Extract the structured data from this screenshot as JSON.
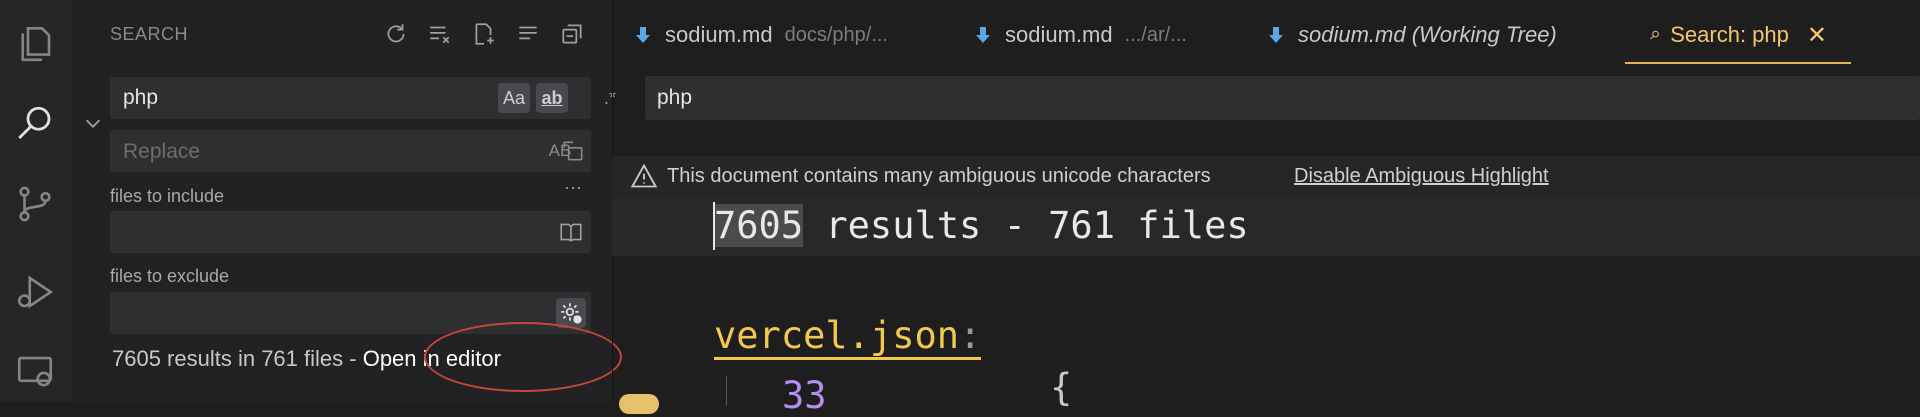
{
  "activity_bar": {
    "items": [
      "explorer-icon",
      "search-icon",
      "source-control-icon",
      "run-debug-icon",
      "remote-explorer-icon"
    ]
  },
  "sidebar": {
    "title": "SEARCH",
    "search": {
      "value": "php",
      "options": [
        "Aa",
        "ab"
      ],
      "regex_label": ".*"
    },
    "replace": {
      "placeholder": "Replace",
      "preserve_case": "AB"
    },
    "more": "···",
    "include": {
      "label": "files to include",
      "value": ""
    },
    "exclude": {
      "label": "files to exclude",
      "value": ""
    },
    "summary": {
      "text": "7605 results in 761 files - ",
      "link": "Open in editor"
    }
  },
  "tabs": [
    {
      "name": "sodium.md",
      "desc": "docs/php/...",
      "italic": false,
      "active": false
    },
    {
      "name": "sodium.md",
      "desc": ".../ar/...",
      "italic": false,
      "active": false
    },
    {
      "name": "sodium.md (Working Tree)",
      "desc": "",
      "italic": true,
      "active": false
    },
    {
      "name": "Search: php",
      "desc": "",
      "italic": false,
      "active": true
    }
  ],
  "editor": {
    "query": "php",
    "warning": {
      "text": "This document contains many ambiguous unicode characters",
      "action": "Disable Ambiguous Highlight"
    },
    "summary_selected": "7605",
    "summary_rest": " results - 761 files",
    "file": "vercel.json",
    "colon": ":",
    "line_number": "33",
    "brace": "{"
  },
  "colors": {
    "accent": "#f5c56b",
    "annotation": "#c7453a",
    "purple": "#b48ef0"
  }
}
